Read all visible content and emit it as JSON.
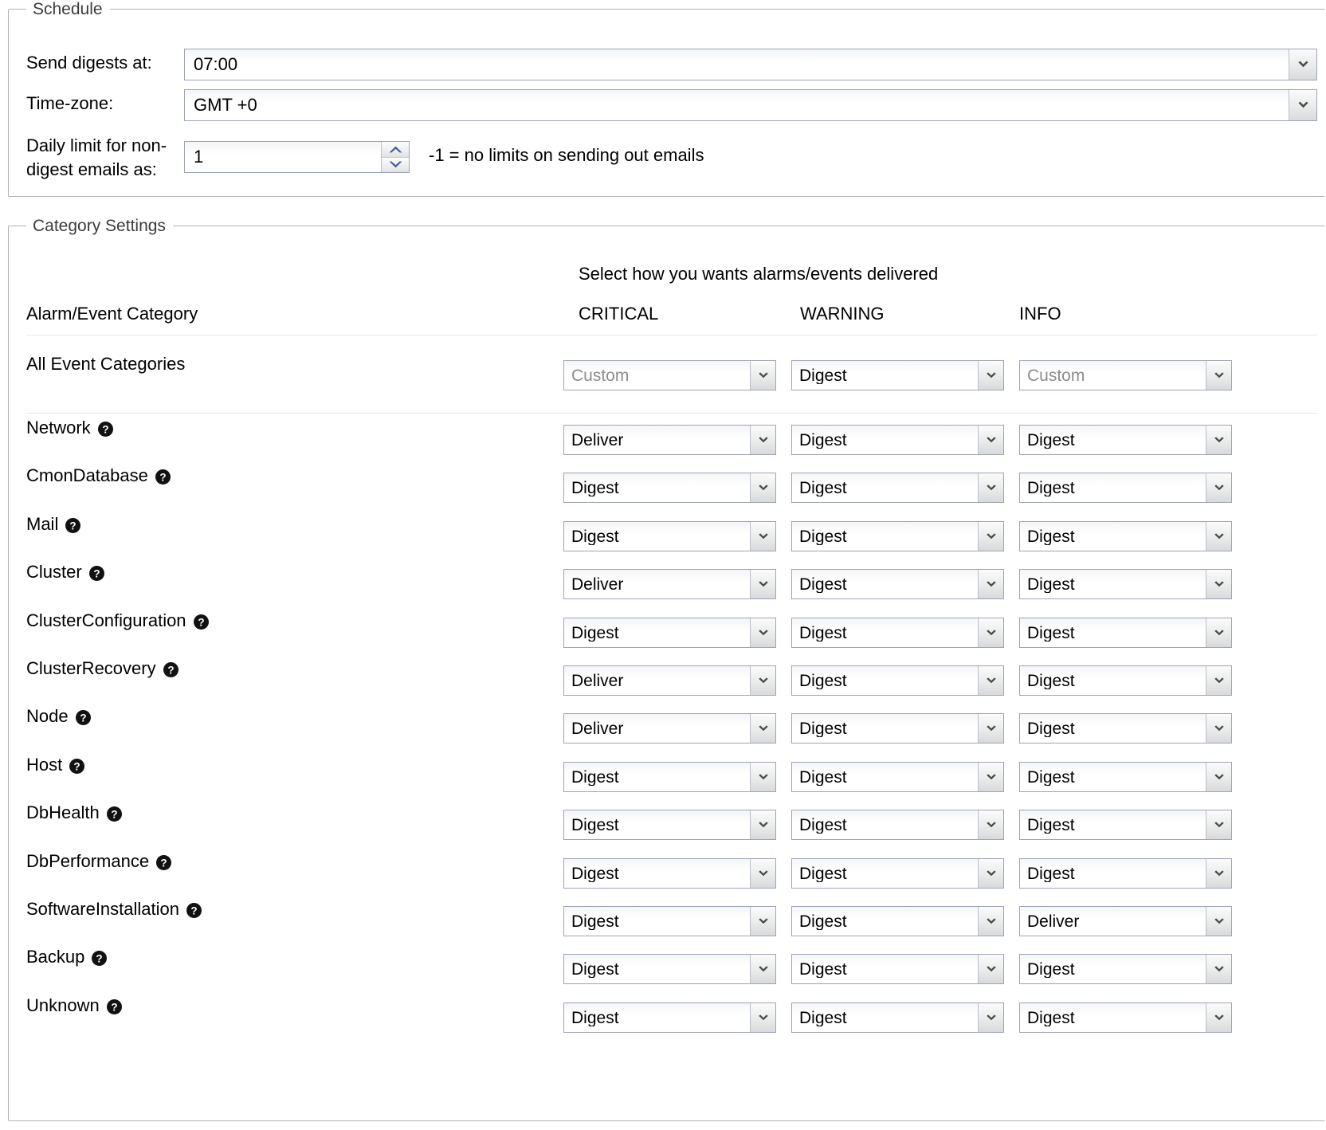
{
  "schedule": {
    "legend": "Schedule",
    "send_digests_label": "Send digests at:",
    "send_digests_value": "07:00",
    "timezone_label": "Time-zone:",
    "timezone_value": "GMT +0",
    "daily_limit_label": "Daily limit for non-\ndigest emails as:",
    "daily_limit_value": "1",
    "daily_limit_hint": "-1 = no limits on sending out emails"
  },
  "category": {
    "legend": "Category Settings",
    "select_how_text": "Select how you wants alarms/events delivered",
    "columns": {
      "category": "Alarm/Event Category",
      "critical": "CRITICAL",
      "warning": "WARNING",
      "info": "INFO"
    },
    "all_row": {
      "label": "All Event Categories",
      "critical": "Custom",
      "warning": "Digest",
      "info": "Custom",
      "critical_muted": true,
      "warning_muted": false,
      "info_muted": true
    },
    "help_icon": "help-circle-icon",
    "rows": [
      {
        "label": "Network",
        "critical": "Deliver",
        "warning": "Digest",
        "info": "Digest"
      },
      {
        "label": "CmonDatabase",
        "critical": "Digest",
        "warning": "Digest",
        "info": "Digest"
      },
      {
        "label": "Mail",
        "critical": "Digest",
        "warning": "Digest",
        "info": "Digest"
      },
      {
        "label": "Cluster",
        "critical": "Deliver",
        "warning": "Digest",
        "info": "Digest"
      },
      {
        "label": "ClusterConfiguration",
        "critical": "Digest",
        "warning": "Digest",
        "info": "Digest"
      },
      {
        "label": "ClusterRecovery",
        "critical": "Deliver",
        "warning": "Digest",
        "info": "Digest"
      },
      {
        "label": "Node",
        "critical": "Deliver",
        "warning": "Digest",
        "info": "Digest"
      },
      {
        "label": "Host",
        "critical": "Digest",
        "warning": "Digest",
        "info": "Digest"
      },
      {
        "label": "DbHealth",
        "critical": "Digest",
        "warning": "Digest",
        "info": "Digest"
      },
      {
        "label": "DbPerformance",
        "critical": "Digest",
        "warning": "Digest",
        "info": "Digest"
      },
      {
        "label": "SoftwareInstallation",
        "critical": "Digest",
        "warning": "Digest",
        "info": "Deliver"
      },
      {
        "label": "Backup",
        "critical": "Digest",
        "warning": "Digest",
        "info": "Digest"
      },
      {
        "label": "Unknown",
        "critical": "Digest",
        "warning": "Digest",
        "info": "Digest"
      }
    ]
  },
  "colors": {
    "frame_border": "#b2b2c0",
    "control_border": "#9fa3b8",
    "muted_text": "#8c8c8c",
    "spinner_arrow": "#3d5a8e",
    "rule": "#e6e6e6"
  }
}
